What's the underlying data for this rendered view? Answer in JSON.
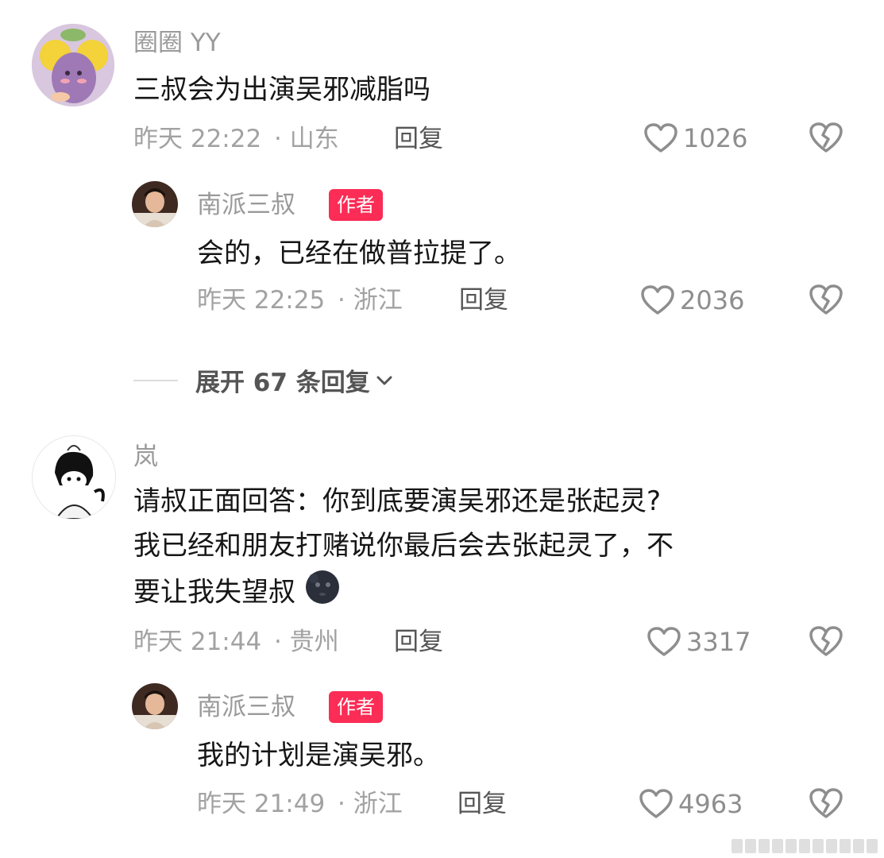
{
  "comments": [
    {
      "user": "圈圈 YY",
      "text": "三叔会为出演吴邪减脂吗",
      "time": "昨天 22:22",
      "location": "· 山东",
      "reply_label": "回复",
      "likes": "1026",
      "reply": {
        "user": "南派三叔",
        "badge": "作者",
        "text": "会的，已经在做普拉提了。",
        "time": "昨天 22:25",
        "location": "· 浙江",
        "reply_label": "回复",
        "likes": "2036"
      },
      "expand_label": "展开 67 条回复"
    },
    {
      "user": "岚",
      "text_lines": [
        "请叔正面回答：你到底要演吴邪还是张起灵?",
        "我已经和朋友打赌说你最后会去张起灵了，不",
        "要让我失望叔"
      ],
      "emoji": "new-moon-face-emoji",
      "time": "昨天 21:44",
      "location": "· 贵州",
      "reply_label": "回复",
      "likes": "3317",
      "reply": {
        "user": "南派三叔",
        "badge": "作者",
        "text": "我的计划是演吴邪。",
        "time": "昨天 21:49",
        "location": "· 浙江",
        "reply_label": "回复",
        "likes": "4963"
      }
    }
  ],
  "colors": {
    "badge": "#fb2c55",
    "meta": "#a2a2a2",
    "text": "#161616"
  },
  "icons": [
    "heart-outline-icon",
    "broken-heart-icon",
    "chevron-down-icon"
  ]
}
